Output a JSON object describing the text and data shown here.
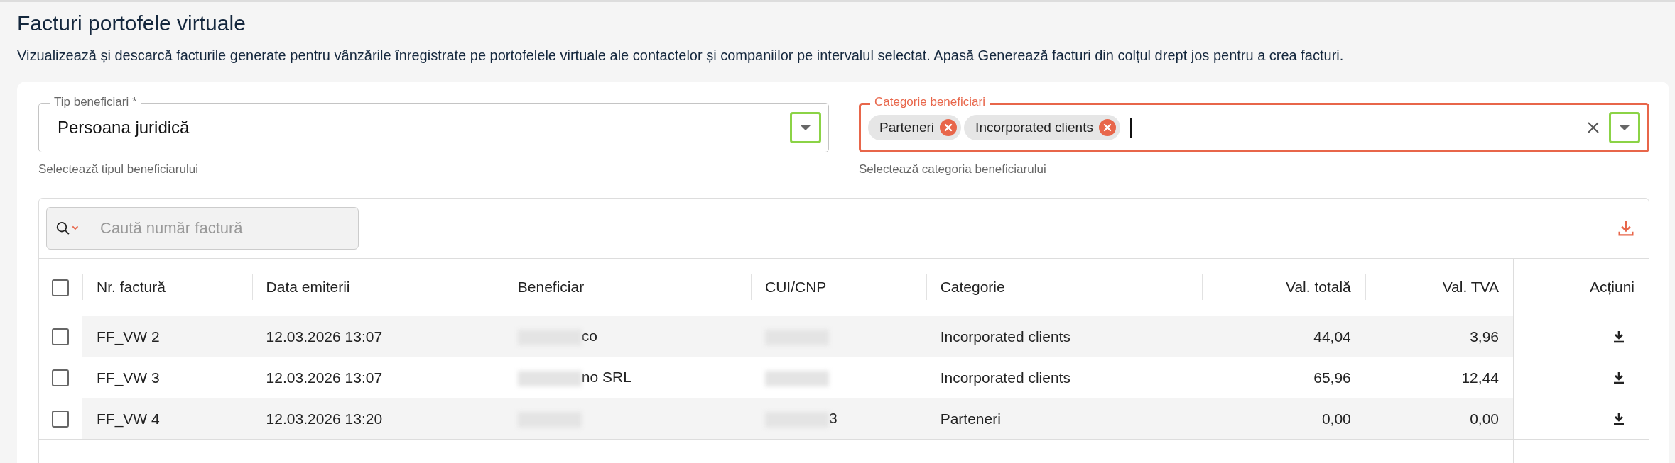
{
  "page": {
    "title": "Facturi portofele virtuale",
    "description": "Vizualizează și descarcă facturile generate pentru vânzările înregistrate pe portofelele virtuale ale contactelor și companiilor pe intervalul selectat. Apasă Generează facturi din colțul drept jos pentru a crea facturi."
  },
  "filters": [
    {
      "kind": "select",
      "label": "Tip beneficiari *",
      "value": "Persoana juridică",
      "helper": "Selectează tipul beneficiarului",
      "focused": false,
      "toggle_highlighted": true
    },
    {
      "kind": "multiselect",
      "label": "Categorie beneficiari",
      "chips": [
        "Parteneri",
        "Incorporated clients"
      ],
      "helper": "Selectează categoria beneficiarului",
      "focused": true,
      "toggle_highlighted": true
    }
  ],
  "search": {
    "placeholder": "Caută număr factură"
  },
  "table": {
    "all_checked": false,
    "columns": [
      {
        "label": "Nr. factură"
      },
      {
        "label": "Data emiterii"
      },
      {
        "label": "Beneficiar"
      },
      {
        "label": "CUI/CNP"
      },
      {
        "label": "Categorie"
      },
      {
        "label": "Val. totală"
      },
      {
        "label": "Val. TVA"
      },
      {
        "label": "Acțiuni"
      }
    ],
    "rows": [
      {
        "checked": false,
        "cells": [
          "FF_VW 2",
          "12.03.2026 13:07",
          "co",
          "",
          "Incorporated clients",
          "44,04",
          "3,96"
        ]
      },
      {
        "checked": false,
        "cells": [
          "FF_VW 3",
          "12.03.2026 13:07",
          "no SRL",
          "",
          "Incorporated clients",
          "65,96",
          "12,44"
        ]
      },
      {
        "checked": false,
        "cells": [
          "FF_VW 4",
          "12.03.2026 13:20",
          "",
          "3",
          "Parteneri",
          "0,00",
          "0,00"
        ]
      }
    ]
  }
}
